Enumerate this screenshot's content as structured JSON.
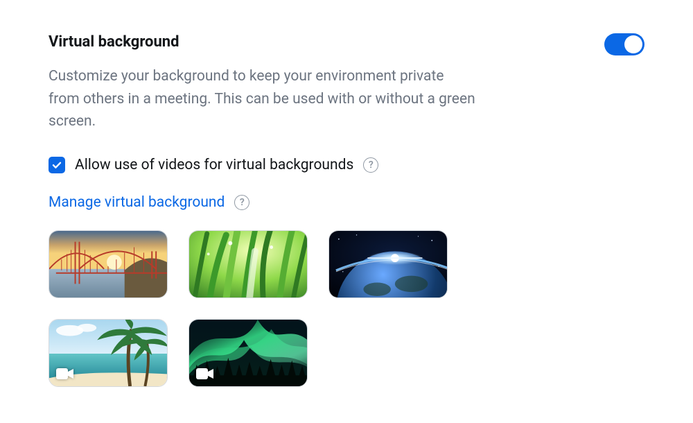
{
  "setting": {
    "title": "Virtual background",
    "description": "Customize your background to keep your environment private from others in a meeting. This can be used with or without a green screen.",
    "enabled": true
  },
  "options": {
    "allow_video_bg": {
      "checked": true,
      "label": "Allow use of videos for virtual backgrounds"
    }
  },
  "actions": {
    "manage_label": "Manage virtual background"
  },
  "thumbnails": [
    {
      "name": "golden-gate-bridge",
      "is_video": false
    },
    {
      "name": "green-grass",
      "is_video": false
    },
    {
      "name": "earth-from-space",
      "is_video": false
    },
    {
      "name": "tropical-beach",
      "is_video": true
    },
    {
      "name": "aurora-borealis",
      "is_video": true
    }
  ],
  "colors": {
    "accent": "#0b68e5",
    "text_muted": "#6c7480"
  }
}
